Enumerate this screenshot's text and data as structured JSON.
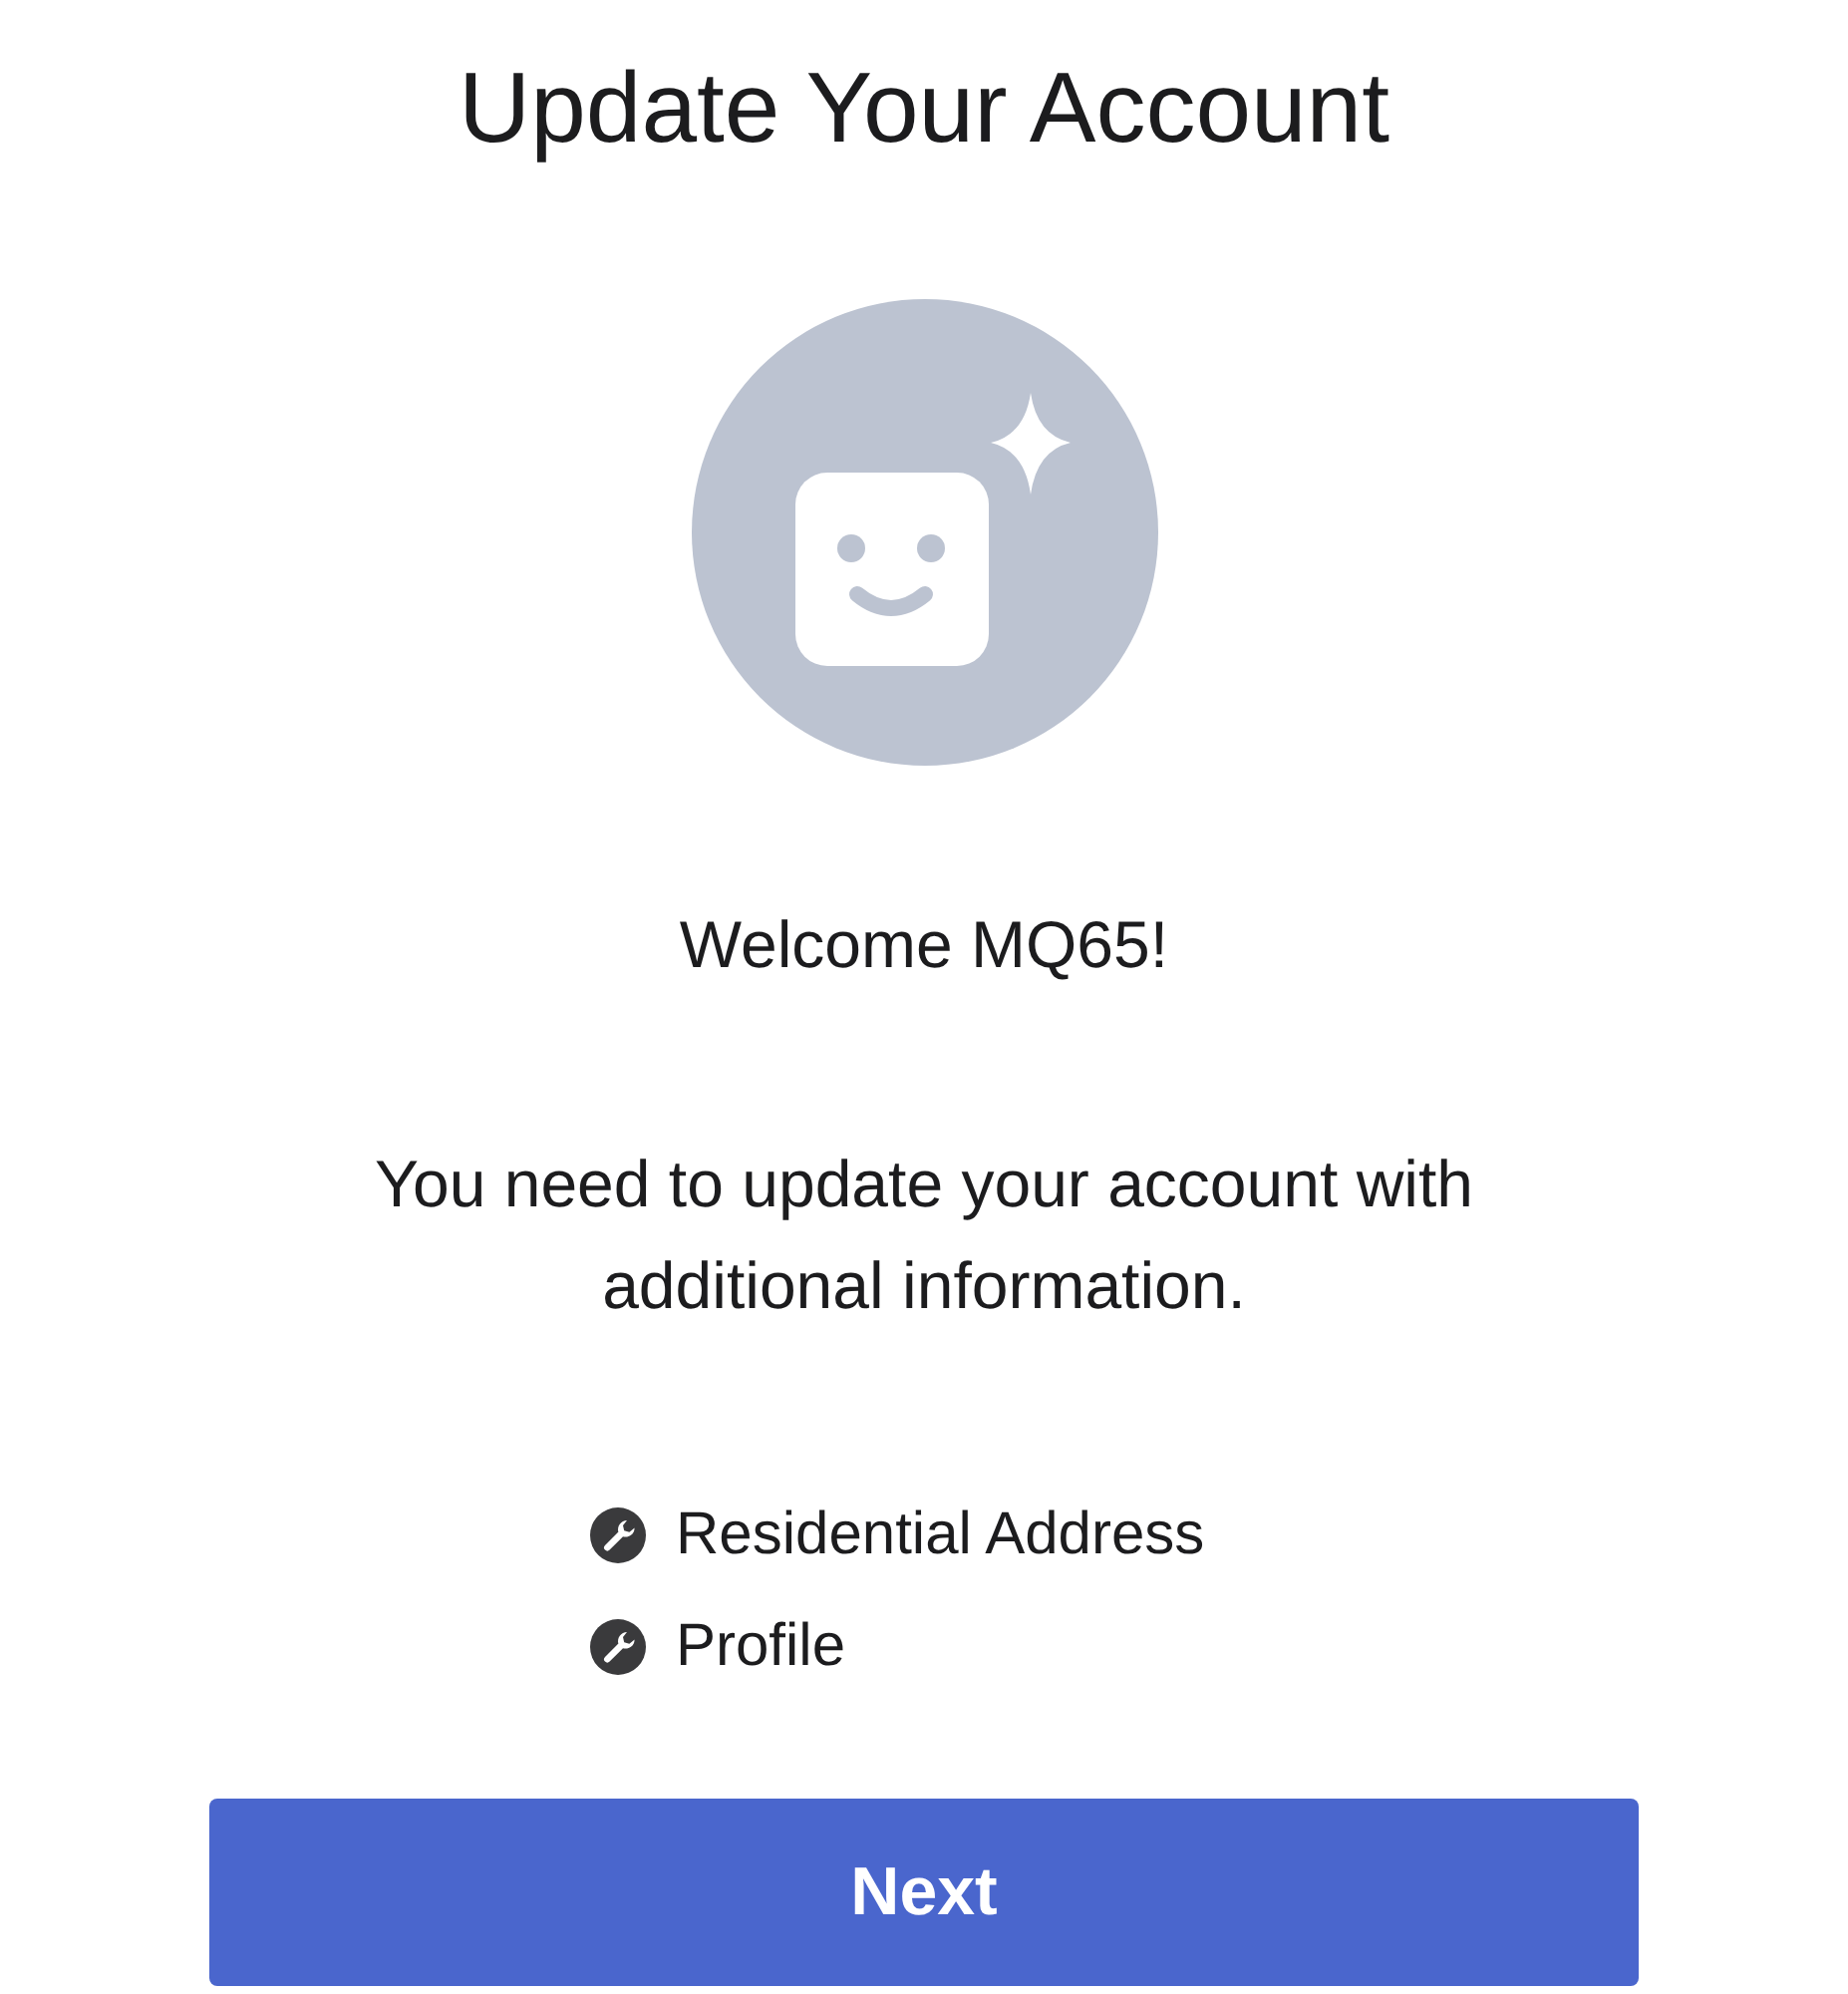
{
  "title": "Update Your Account",
  "welcome": "Welcome MQ65!",
  "message": "You need to update your account with additional information.",
  "items": [
    {
      "label": "Residential Address"
    },
    {
      "label": "Profile"
    }
  ],
  "button": {
    "label": "Next"
  }
}
